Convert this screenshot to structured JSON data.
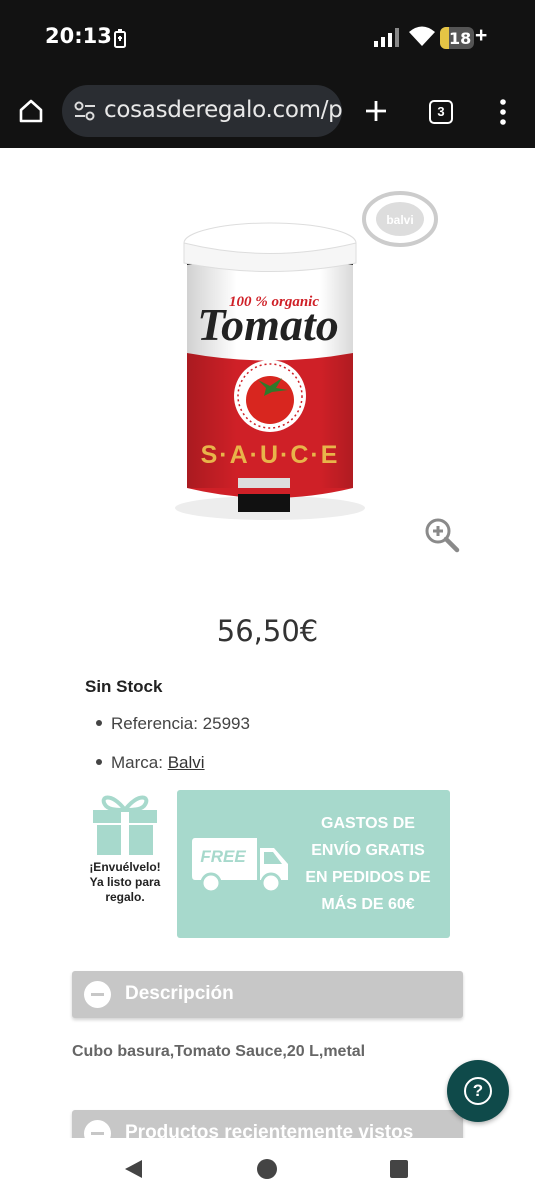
{
  "status": {
    "time": "20:13",
    "battery": "18"
  },
  "browser": {
    "url": "cosasderegalo.com/p",
    "tab_count": "3",
    "home_icon": "home-icon",
    "site_settings_icon": "tune-icon",
    "new_tab_icon": "plus-icon",
    "menu_icon": "more-vert-icon"
  },
  "product": {
    "image_labels": {
      "top": "100 % organic",
      "name": "Tomato",
      "bottom": "S·A·U·C·E",
      "logo": "balvi"
    },
    "price": "56,50€",
    "stock": "Sin Stock",
    "reference_label": "Referencia: 25993",
    "brand_label": "Marca: ",
    "brand_name": "Balvi"
  },
  "gift": {
    "line1": "¡Envuélvelo!",
    "line2": "Ya listo para",
    "line3": "regalo."
  },
  "shipping": {
    "truck_label": "FREE",
    "line1": "GASTOS DE",
    "line2": "ENVÍO GRATIS",
    "line3": "EN PEDIDOS DE",
    "line4": "MÁS DE 60€"
  },
  "accordions": {
    "description_title": "Descripción",
    "description_text": "Cubo basura,Tomato Sauce,20 L,metal",
    "recent_title": "Productos recientemente vistos"
  },
  "colors": {
    "teal": "#a7d9cc",
    "help_button": "#0f4a4a",
    "accordion": "#c7c7c7",
    "can_red": "#cf2027"
  }
}
